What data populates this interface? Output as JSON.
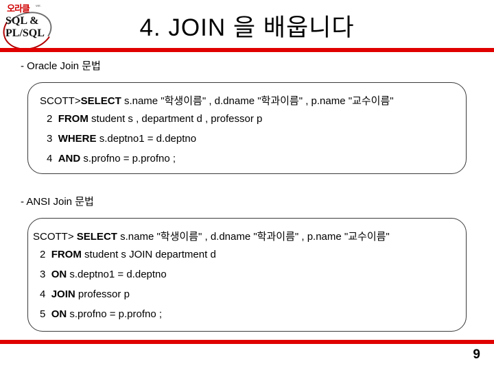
{
  "logo": {
    "korean": "오라클",
    "tiny": "ver.",
    "line1": "SQL &",
    "line2": "PL/SQL"
  },
  "slide": {
    "title": "4. JOIN 을 배웁니다",
    "page_number": "9",
    "accent_color": "#e00000"
  },
  "sections": [
    {
      "heading": "- Oracle Join 문법",
      "lines": [
        {
          "num": "",
          "prompt": "SCOTT>",
          "keyword": "SELECT",
          "rest": " s.name \"학생이름\" , d.dname \"학과이름\" , p.name \"교수이름\""
        },
        {
          "num": "2",
          "prompt": "",
          "keyword": "FROM",
          "rest": " student  s , department  d , professor  p"
        },
        {
          "num": "3",
          "prompt": "",
          "keyword": "WHERE",
          "rest": " s.deptno1 = d.deptno"
        },
        {
          "num": "4",
          "prompt": "",
          "keyword": "AND",
          "rest": " s.profno = p.profno ;"
        }
      ]
    },
    {
      "heading": "- ANSI Join 문법",
      "lines": [
        {
          "num": "",
          "prompt": "SCOTT>",
          "keyword": " SELECT",
          "rest": " s.name \"학생이름\" , d.dname \"학과이름\" , p.name \"교수이름\""
        },
        {
          "num": "2",
          "prompt": "",
          "keyword": "FROM",
          "rest": " student s JOIN department d"
        },
        {
          "num": "3",
          "prompt": "",
          "keyword": "ON",
          "rest": " s.deptno1 = d.deptno"
        },
        {
          "num": "4",
          "prompt": "",
          "keyword": "JOIN",
          "rest": " professor p"
        },
        {
          "num": "5",
          "prompt": "",
          "keyword": "ON",
          "rest": " s.profno = p.profno ;"
        }
      ]
    }
  ]
}
